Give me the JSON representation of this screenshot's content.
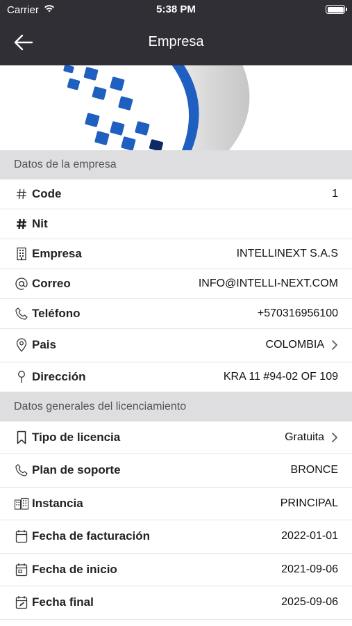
{
  "status_bar": {
    "carrier": "Carrier",
    "time": "5:38 PM"
  },
  "nav": {
    "title": "Empresa"
  },
  "sections": {
    "company_header": "Datos de la empresa",
    "license_header": "Datos generales del licenciamiento"
  },
  "company": {
    "code_label": "Code",
    "code_value": "1",
    "nit_label": "Nit",
    "nit_value": "",
    "empresa_label": "Empresa",
    "empresa_value": "INTELLINEXT S.A.S",
    "correo_label": "Correo",
    "correo_value": "INFO@INTELLI-NEXT.COM",
    "telefono_label": "Teléfono",
    "telefono_value": "+570316956100",
    "pais_label": "Pais",
    "pais_value": "COLOMBIA",
    "direccion_label": "Dirección",
    "direccion_value": "KRA 11 #94-02 OF 109"
  },
  "license": {
    "tipo_label": "Tipo de licencia",
    "tipo_value": "Gratuita",
    "soporte_label": "Plan de soporte",
    "soporte_value": "BRONCE",
    "instancia_label": "Instancia",
    "instancia_value": "PRINCIPAL",
    "facturacion_label": "Fecha de facturación",
    "facturacion_value": "2022-01-01",
    "inicio_label": "Fecha de inicio",
    "inicio_value": "2021-09-06",
    "final_label": "Fecha final",
    "final_value": "2025-09-06"
  },
  "icons": {
    "back": "arrow-left-icon",
    "wifi": "wifi-icon",
    "battery": "battery-icon",
    "code": "hash-icon",
    "nit": "hash-icon",
    "empresa": "building-icon",
    "correo": "at-icon",
    "telefono": "phone-icon",
    "pais": "location-pin-icon",
    "direccion": "map-pin-icon",
    "tipo": "bookmark-icon",
    "soporte": "phone-icon",
    "instancia": "buildings-icon",
    "facturacion": "calendar-icon",
    "inicio": "calendar-icon",
    "final": "calendar-edit-icon",
    "chevron": "chevron-right-icon"
  },
  "colors": {
    "nav_background": "#2f2f35",
    "section_background": "#dedee0",
    "banner_blue": "#1f5fbf"
  }
}
